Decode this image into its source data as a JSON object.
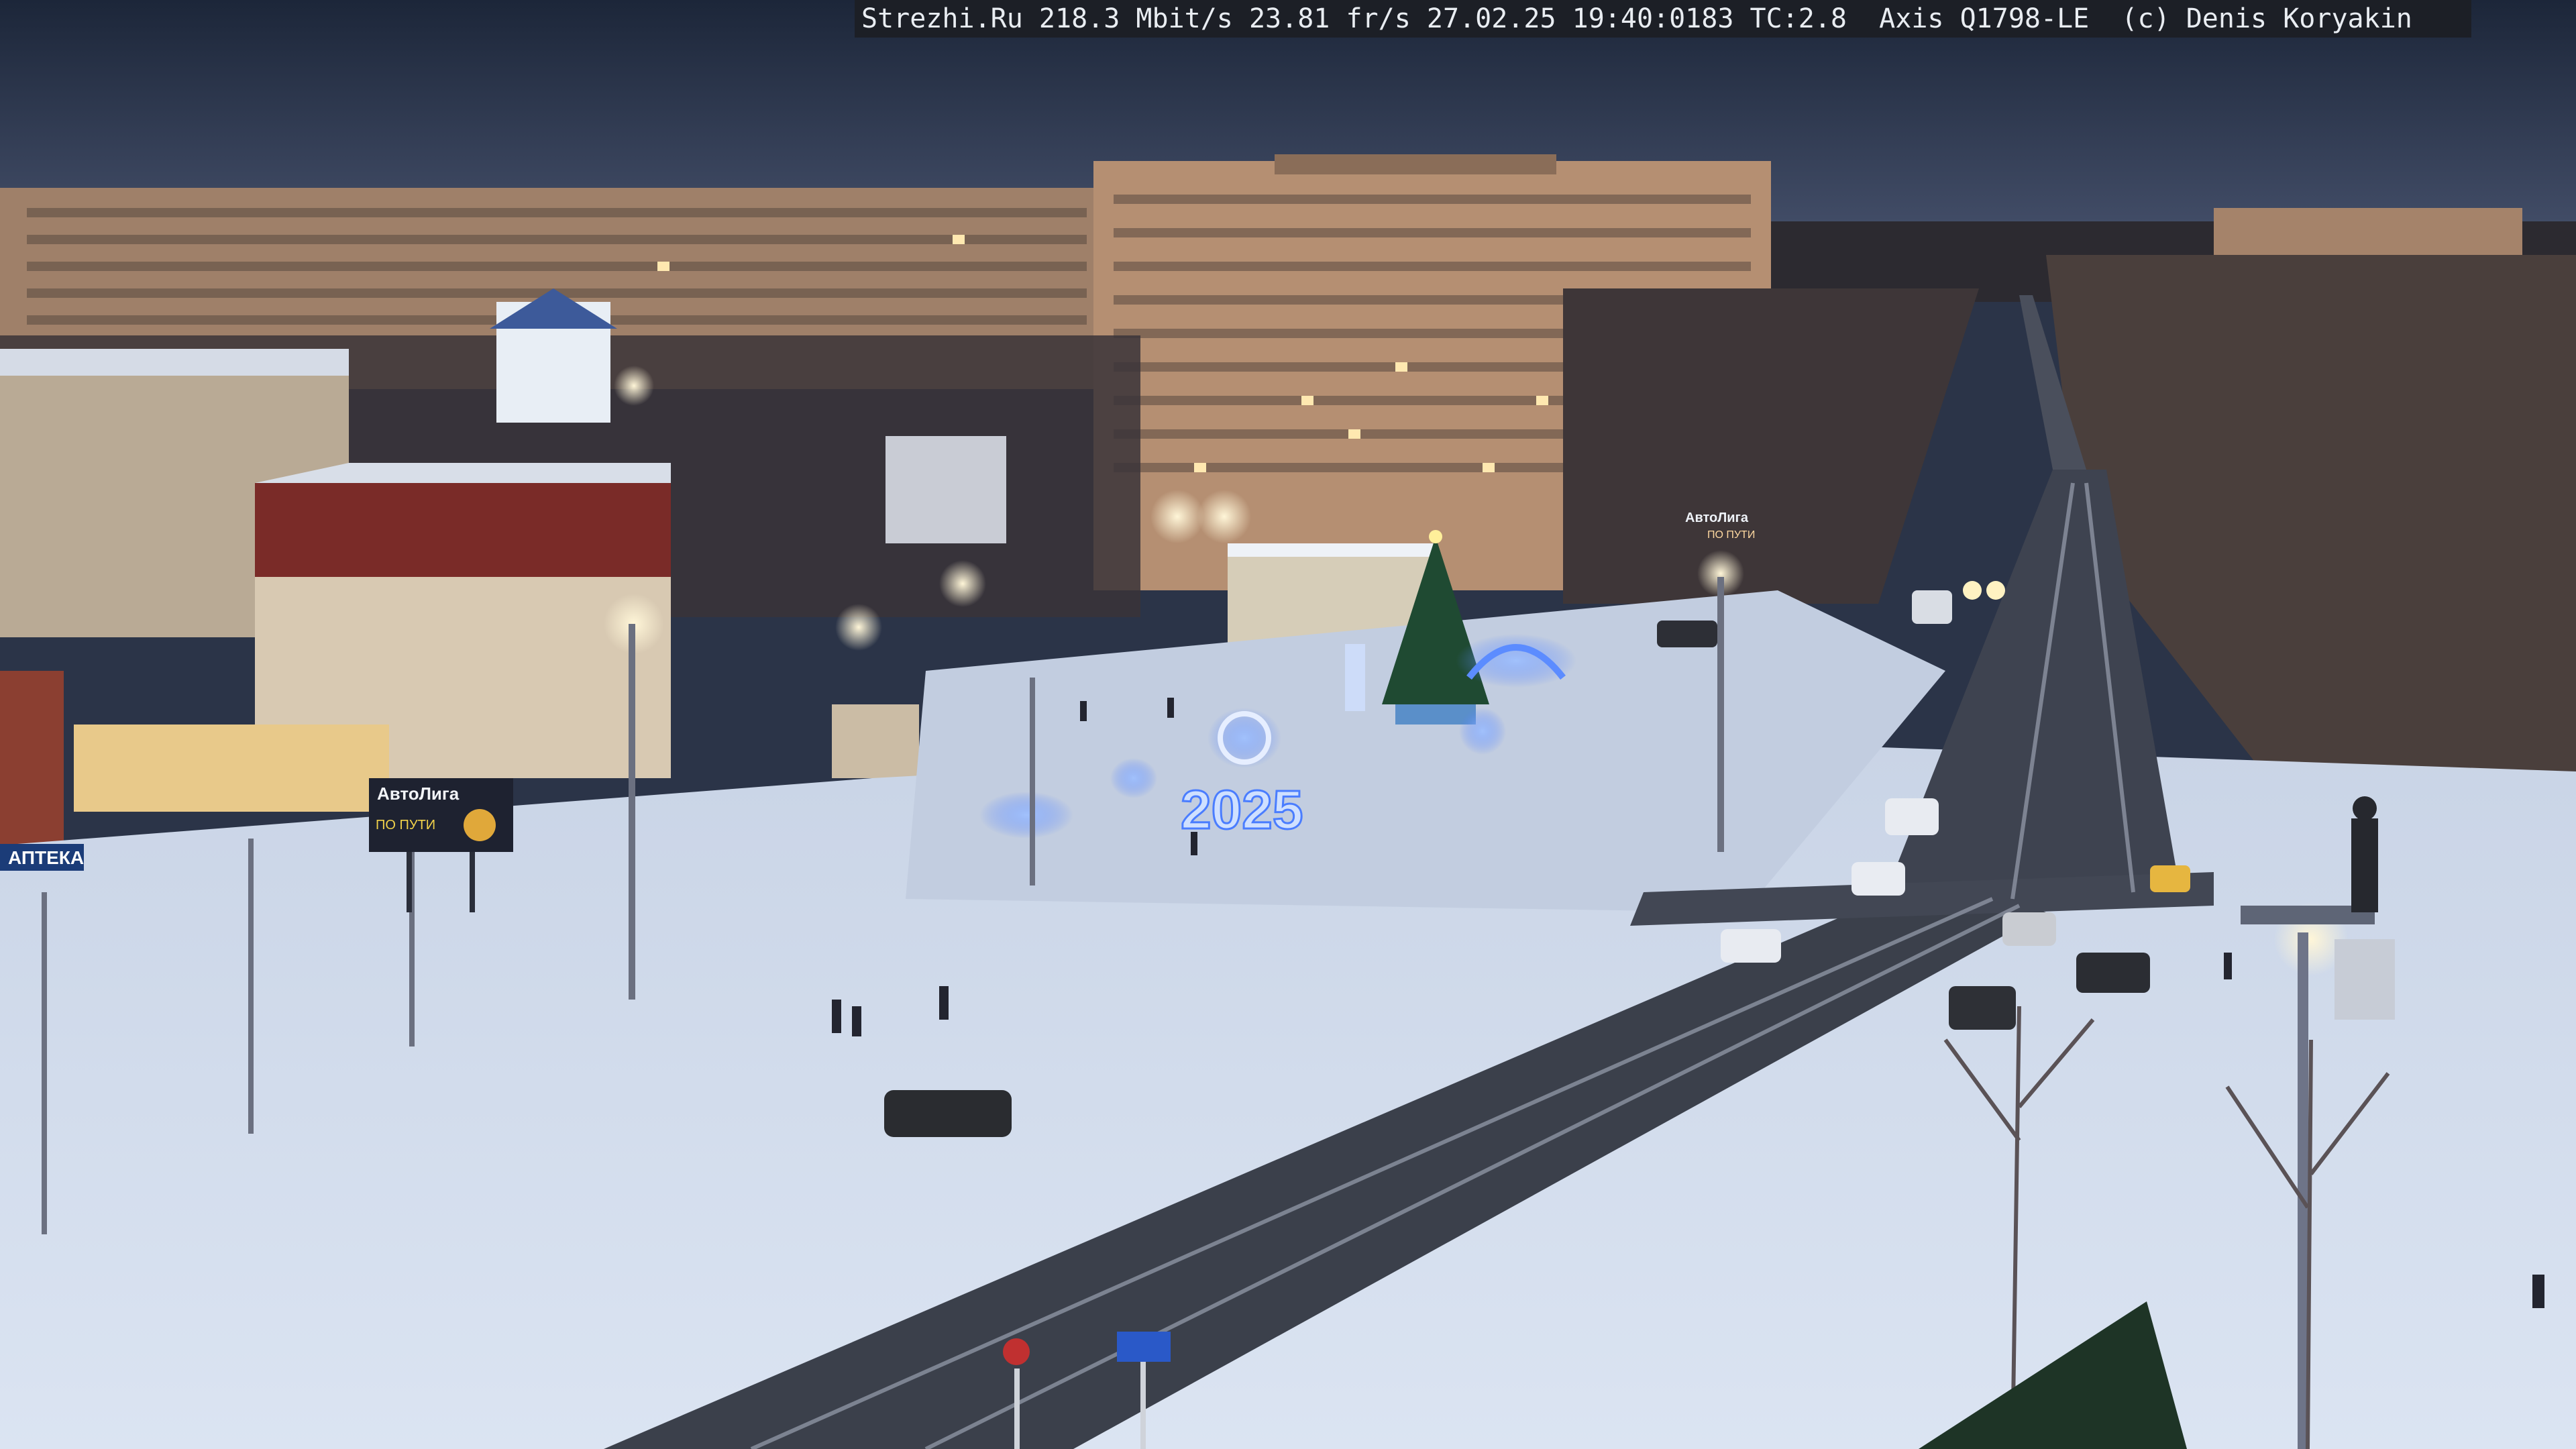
{
  "camera_overlay": {
    "text": "Strezhi.Ru 218.3 Mbit/s 23.81 fr/s 27.02.25 19:40:0183 TC:2.8  Axis Q1798-LE  (c) Denis Koryakin"
  },
  "signs": {
    "year_lights": "2025",
    "billboard_brand": "АвтоЛига",
    "billboard_sub": "ПО ПУТИ",
    "pharmacy": "АПТЕКА",
    "shop_sign": "АвтоЛига",
    "shop_sub": "ПО ПУТИ"
  },
  "colors": {
    "sky_top": "#1f2a40",
    "sky_bottom": "#4a5570",
    "snow": "#d9e2f0",
    "road": "#3a3f4a",
    "building_warm": "#b78f6e",
    "festive_blue": "#3f7bff"
  }
}
